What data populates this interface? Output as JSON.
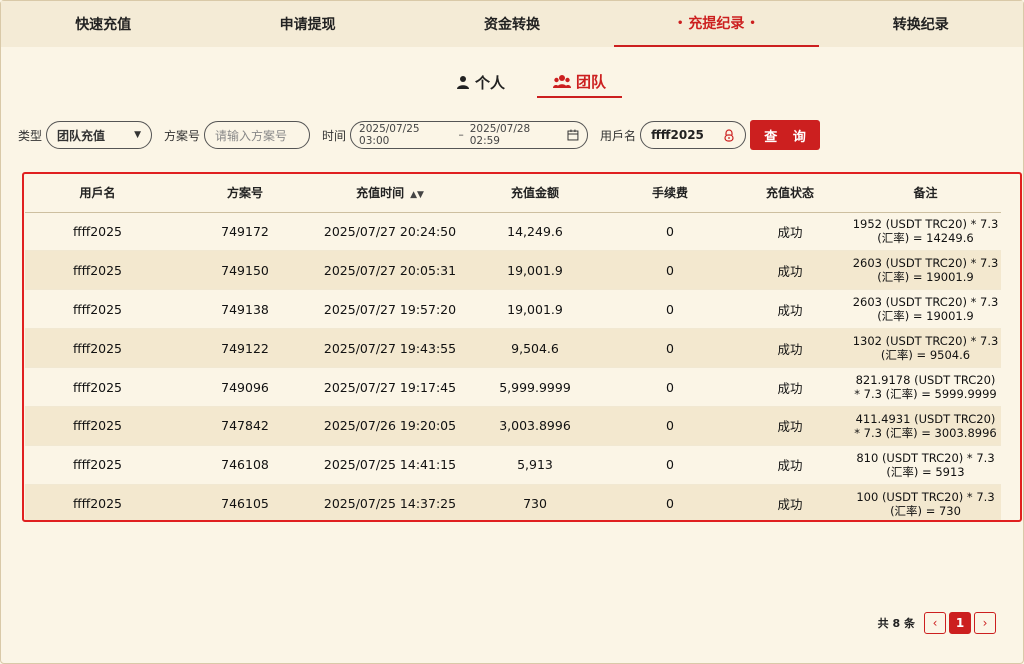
{
  "tabs": [
    {
      "label": "快速充值"
    },
    {
      "label": "申请提现"
    },
    {
      "label": "资金转换"
    },
    {
      "label": "充提纪录",
      "active": true
    },
    {
      "label": "转换纪录"
    }
  ],
  "scope": {
    "personal": "个人",
    "team": "团队"
  },
  "filters": {
    "type_label": "类型",
    "type_value": "团队充值",
    "case_label": "方案号",
    "case_placeholder": "请输入方案号",
    "time_label": "时间",
    "time_start": "2025/07/25 03:00",
    "time_sep": "–",
    "time_end": "2025/07/28 02:59",
    "user_label": "用戶名",
    "user_value": "ffff2025",
    "query_button": "查 询"
  },
  "table": {
    "headers": [
      "用戶名",
      "方案号",
      "充值时间",
      "充值金额",
      "手续费",
      "充值状态",
      "备注"
    ],
    "rows": [
      [
        "ffff2025",
        "749172",
        "2025/07/27 20:24:50",
        "14,249.6",
        "0",
        "成功",
        "1952 (USDT TRC20) * 7.3 (汇率) = 14249.6"
      ],
      [
        "ffff2025",
        "749150",
        "2025/07/27 20:05:31",
        "19,001.9",
        "0",
        "成功",
        "2603 (USDT TRC20) * 7.3 (汇率) = 19001.9"
      ],
      [
        "ffff2025",
        "749138",
        "2025/07/27 19:57:20",
        "19,001.9",
        "0",
        "成功",
        "2603 (USDT TRC20) * 7.3 (汇率) = 19001.9"
      ],
      [
        "ffff2025",
        "749122",
        "2025/07/27 19:43:55",
        "9,504.6",
        "0",
        "成功",
        "1302 (USDT TRC20) * 7.3 (汇率) = 9504.6"
      ],
      [
        "ffff2025",
        "749096",
        "2025/07/27 19:17:45",
        "5,999.9999",
        "0",
        "成功",
        "821.9178 (USDT TRC20) * 7.3 (汇率) = 5999.9999"
      ],
      [
        "ffff2025",
        "747842",
        "2025/07/26 19:20:05",
        "3,003.8996",
        "0",
        "成功",
        "411.4931 (USDT TRC20) * 7.3 (汇率) = 3003.8996"
      ],
      [
        "ffff2025",
        "746108",
        "2025/07/25 14:41:15",
        "5,913",
        "0",
        "成功",
        "810 (USDT TRC20) * 7.3 (汇率) = 5913"
      ],
      [
        "ffff2025",
        "746105",
        "2025/07/25 14:37:25",
        "730",
        "0",
        "成功",
        "100 (USDT TRC20) * 7.3 (汇率) = 730"
      ]
    ]
  },
  "pager": {
    "total": "共 8 条",
    "current": "1"
  },
  "colors": {
    "accent": "#cc1f1f",
    "background": "#fbf5e6"
  }
}
